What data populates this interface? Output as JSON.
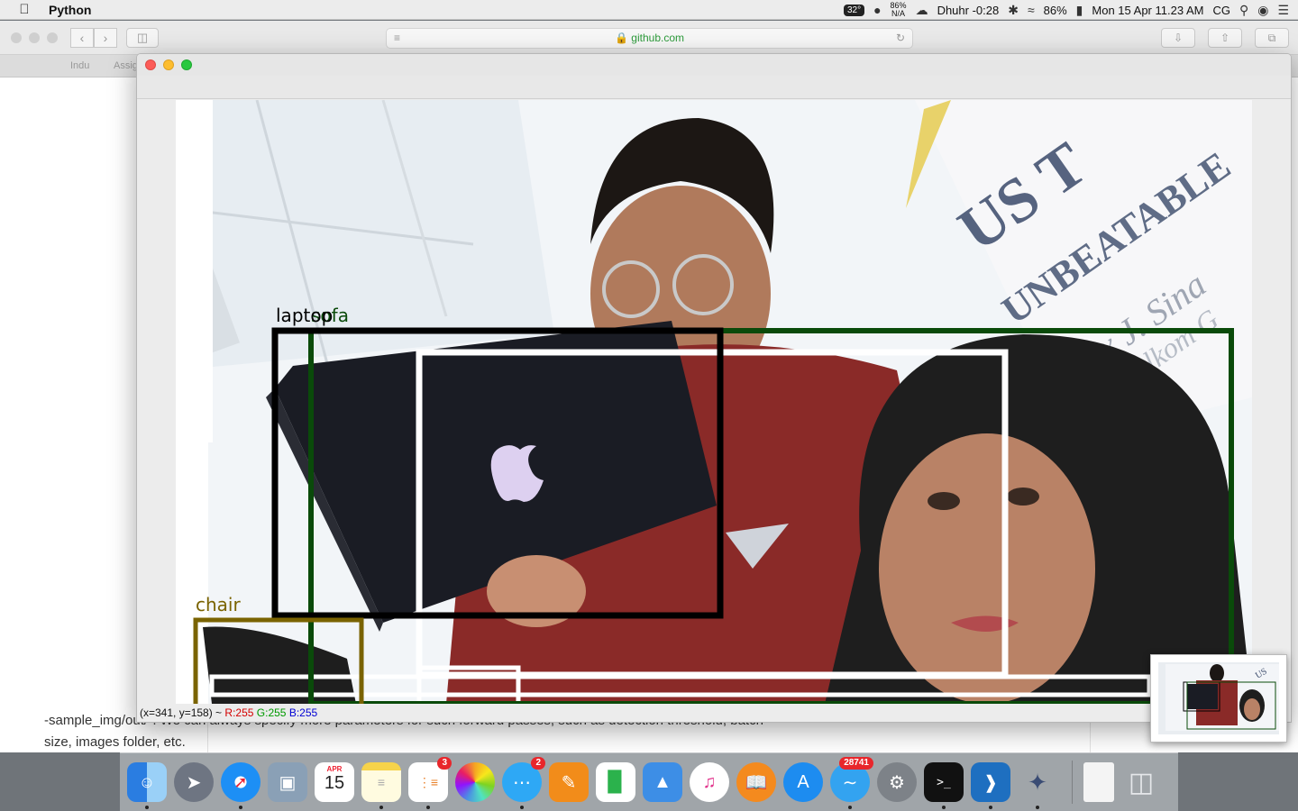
{
  "menubar": {
    "app_name": "Python",
    "temperature": "32°",
    "battery_stack_top": "86%",
    "battery_stack_bottom": "N/A",
    "prayer": "Dhuhr -0:28",
    "battery": "86%",
    "datetime": "Mon 15 Apr  11.23 AM",
    "user": "CG"
  },
  "safari": {
    "address": "github.com",
    "tabs": [
      "Indu",
      "Assig"
    ],
    "page_lines": [
      "-sample_img/out/\". We can always specify more parameters for such forward passes, such as detection threshold, batch",
      "size, images folder, etc."
    ]
  },
  "pywin": {
    "status": {
      "coords": "(x=341, y=158) ~ ",
      "r": "R:255",
      "g": "G:255",
      "b": "B:255"
    }
  },
  "detections": [
    {
      "label": "laptop",
      "color": "#000000"
    },
    {
      "label": "sofa",
      "color": "#0a4a0a"
    },
    {
      "label": "chair",
      "color": "#7a6300"
    }
  ],
  "dock": {
    "calendar_month": "APR",
    "calendar_day": "15",
    "reminders_badge": "3",
    "messages_badge": "2",
    "news_badge": "28741",
    "apps": [
      "finder",
      "launchpad",
      "safari",
      "preview",
      "calendar",
      "notes",
      "reminders",
      "photos",
      "messages",
      "pages",
      "numbers",
      "keynote",
      "itunes",
      "ibooks",
      "app-store",
      "news",
      "system-preferences",
      "terminal",
      "vscode",
      "rocket",
      "document",
      "trash"
    ]
  }
}
